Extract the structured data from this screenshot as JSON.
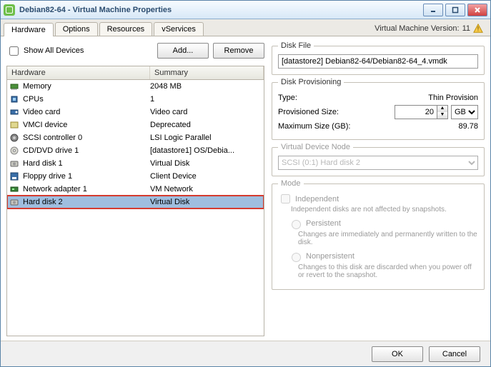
{
  "window": {
    "title": "Debian82-64 - Virtual Machine Properties",
    "version_label": "Virtual Machine Version:",
    "version_value": "11"
  },
  "tabs": [
    "Hardware",
    "Options",
    "Resources",
    "vServices"
  ],
  "active_tab": 0,
  "toolbar": {
    "show_all": "Show All Devices",
    "add": "Add...",
    "remove": "Remove"
  },
  "list": {
    "headers": [
      "Hardware",
      "Summary"
    ],
    "rows": [
      {
        "icon": "memory",
        "name": "Memory",
        "summary": "2048 MB"
      },
      {
        "icon": "cpu",
        "name": "CPUs",
        "summary": "1"
      },
      {
        "icon": "video",
        "name": "Video card",
        "summary": "Video card"
      },
      {
        "icon": "vmci",
        "name": "VMCI device",
        "summary": "Deprecated"
      },
      {
        "icon": "scsi",
        "name": "SCSI controller 0",
        "summary": "LSI Logic Parallel"
      },
      {
        "icon": "cd",
        "name": "CD/DVD drive 1",
        "summary": "[datastore1] OS/Debia..."
      },
      {
        "icon": "hdd",
        "name": "Hard disk 1",
        "summary": "Virtual Disk"
      },
      {
        "icon": "floppy",
        "name": "Floppy drive 1",
        "summary": "Client Device"
      },
      {
        "icon": "nic",
        "name": "Network adapter 1",
        "summary": "VM Network"
      },
      {
        "icon": "hdd",
        "name": "Hard disk 2",
        "summary": "Virtual Disk",
        "selected": true,
        "highlight": true
      }
    ]
  },
  "detail": {
    "diskfile_legend": "Disk File",
    "diskfile_value": "[datastore2] Debian82-64/Debian82-64_4.vmdk",
    "prov_legend": "Disk Provisioning",
    "type_label": "Type:",
    "type_value": "Thin Provision",
    "provsize_label": "Provisioned Size:",
    "provsize_value": "20",
    "provsize_unit": "GB",
    "maxsize_label": "Maximum Size (GB):",
    "maxsize_value": "89.78",
    "vnode_legend": "Virtual Device Node",
    "vnode_value": "SCSI (0:1) Hard disk 2",
    "mode_legend": "Mode",
    "independent_label": "Independent",
    "independent_desc": "Independent disks are not affected by snapshots.",
    "persistent_label": "Persistent",
    "persistent_desc": "Changes are immediately and permanently written to the disk.",
    "nonpersistent_label": "Nonpersistent",
    "nonpersistent_desc": "Changes to this disk are discarded when you power off or revert to the snapshot."
  },
  "footer": {
    "ok": "OK",
    "cancel": "Cancel"
  }
}
